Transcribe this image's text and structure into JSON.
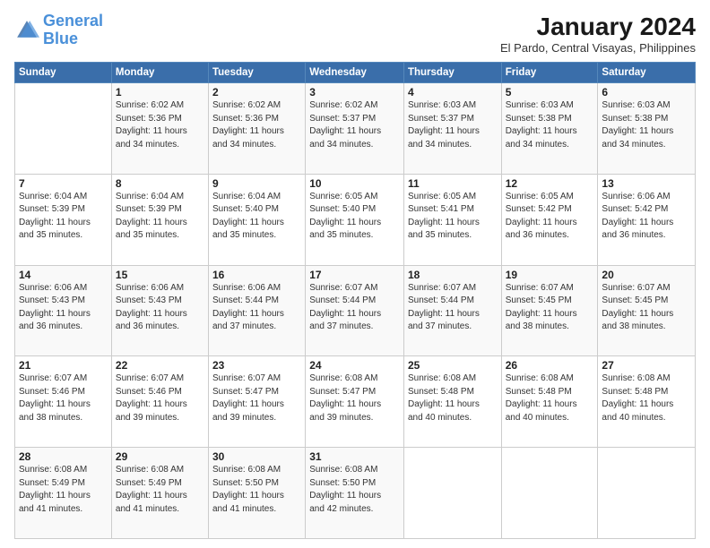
{
  "logo": {
    "line1": "General",
    "line2": "Blue"
  },
  "title": "January 2024",
  "location": "El Pardo, Central Visayas, Philippines",
  "days_header": [
    "Sunday",
    "Monday",
    "Tuesday",
    "Wednesday",
    "Thursday",
    "Friday",
    "Saturday"
  ],
  "weeks": [
    [
      {
        "day": "",
        "sunrise": "",
        "sunset": "",
        "daylight": ""
      },
      {
        "day": "1",
        "sunrise": "Sunrise: 6:02 AM",
        "sunset": "Sunset: 5:36 PM",
        "daylight": "Daylight: 11 hours and 34 minutes."
      },
      {
        "day": "2",
        "sunrise": "Sunrise: 6:02 AM",
        "sunset": "Sunset: 5:36 PM",
        "daylight": "Daylight: 11 hours and 34 minutes."
      },
      {
        "day": "3",
        "sunrise": "Sunrise: 6:02 AM",
        "sunset": "Sunset: 5:37 PM",
        "daylight": "Daylight: 11 hours and 34 minutes."
      },
      {
        "day": "4",
        "sunrise": "Sunrise: 6:03 AM",
        "sunset": "Sunset: 5:37 PM",
        "daylight": "Daylight: 11 hours and 34 minutes."
      },
      {
        "day": "5",
        "sunrise": "Sunrise: 6:03 AM",
        "sunset": "Sunset: 5:38 PM",
        "daylight": "Daylight: 11 hours and 34 minutes."
      },
      {
        "day": "6",
        "sunrise": "Sunrise: 6:03 AM",
        "sunset": "Sunset: 5:38 PM",
        "daylight": "Daylight: 11 hours and 34 minutes."
      }
    ],
    [
      {
        "day": "7",
        "sunrise": "Sunrise: 6:04 AM",
        "sunset": "Sunset: 5:39 PM",
        "daylight": "Daylight: 11 hours and 35 minutes."
      },
      {
        "day": "8",
        "sunrise": "Sunrise: 6:04 AM",
        "sunset": "Sunset: 5:39 PM",
        "daylight": "Daylight: 11 hours and 35 minutes."
      },
      {
        "day": "9",
        "sunrise": "Sunrise: 6:04 AM",
        "sunset": "Sunset: 5:40 PM",
        "daylight": "Daylight: 11 hours and 35 minutes."
      },
      {
        "day": "10",
        "sunrise": "Sunrise: 6:05 AM",
        "sunset": "Sunset: 5:40 PM",
        "daylight": "Daylight: 11 hours and 35 minutes."
      },
      {
        "day": "11",
        "sunrise": "Sunrise: 6:05 AM",
        "sunset": "Sunset: 5:41 PM",
        "daylight": "Daylight: 11 hours and 35 minutes."
      },
      {
        "day": "12",
        "sunrise": "Sunrise: 6:05 AM",
        "sunset": "Sunset: 5:42 PM",
        "daylight": "Daylight: 11 hours and 36 minutes."
      },
      {
        "day": "13",
        "sunrise": "Sunrise: 6:06 AM",
        "sunset": "Sunset: 5:42 PM",
        "daylight": "Daylight: 11 hours and 36 minutes."
      }
    ],
    [
      {
        "day": "14",
        "sunrise": "Sunrise: 6:06 AM",
        "sunset": "Sunset: 5:43 PM",
        "daylight": "Daylight: 11 hours and 36 minutes."
      },
      {
        "day": "15",
        "sunrise": "Sunrise: 6:06 AM",
        "sunset": "Sunset: 5:43 PM",
        "daylight": "Daylight: 11 hours and 36 minutes."
      },
      {
        "day": "16",
        "sunrise": "Sunrise: 6:06 AM",
        "sunset": "Sunset: 5:44 PM",
        "daylight": "Daylight: 11 hours and 37 minutes."
      },
      {
        "day": "17",
        "sunrise": "Sunrise: 6:07 AM",
        "sunset": "Sunset: 5:44 PM",
        "daylight": "Daylight: 11 hours and 37 minutes."
      },
      {
        "day": "18",
        "sunrise": "Sunrise: 6:07 AM",
        "sunset": "Sunset: 5:44 PM",
        "daylight": "Daylight: 11 hours and 37 minutes."
      },
      {
        "day": "19",
        "sunrise": "Sunrise: 6:07 AM",
        "sunset": "Sunset: 5:45 PM",
        "daylight": "Daylight: 11 hours and 38 minutes."
      },
      {
        "day": "20",
        "sunrise": "Sunrise: 6:07 AM",
        "sunset": "Sunset: 5:45 PM",
        "daylight": "Daylight: 11 hours and 38 minutes."
      }
    ],
    [
      {
        "day": "21",
        "sunrise": "Sunrise: 6:07 AM",
        "sunset": "Sunset: 5:46 PM",
        "daylight": "Daylight: 11 hours and 38 minutes."
      },
      {
        "day": "22",
        "sunrise": "Sunrise: 6:07 AM",
        "sunset": "Sunset: 5:46 PM",
        "daylight": "Daylight: 11 hours and 39 minutes."
      },
      {
        "day": "23",
        "sunrise": "Sunrise: 6:07 AM",
        "sunset": "Sunset: 5:47 PM",
        "daylight": "Daylight: 11 hours and 39 minutes."
      },
      {
        "day": "24",
        "sunrise": "Sunrise: 6:08 AM",
        "sunset": "Sunset: 5:47 PM",
        "daylight": "Daylight: 11 hours and 39 minutes."
      },
      {
        "day": "25",
        "sunrise": "Sunrise: 6:08 AM",
        "sunset": "Sunset: 5:48 PM",
        "daylight": "Daylight: 11 hours and 40 minutes."
      },
      {
        "day": "26",
        "sunrise": "Sunrise: 6:08 AM",
        "sunset": "Sunset: 5:48 PM",
        "daylight": "Daylight: 11 hours and 40 minutes."
      },
      {
        "day": "27",
        "sunrise": "Sunrise: 6:08 AM",
        "sunset": "Sunset: 5:48 PM",
        "daylight": "Daylight: 11 hours and 40 minutes."
      }
    ],
    [
      {
        "day": "28",
        "sunrise": "Sunrise: 6:08 AM",
        "sunset": "Sunset: 5:49 PM",
        "daylight": "Daylight: 11 hours and 41 minutes."
      },
      {
        "day": "29",
        "sunrise": "Sunrise: 6:08 AM",
        "sunset": "Sunset: 5:49 PM",
        "daylight": "Daylight: 11 hours and 41 minutes."
      },
      {
        "day": "30",
        "sunrise": "Sunrise: 6:08 AM",
        "sunset": "Sunset: 5:50 PM",
        "daylight": "Daylight: 11 hours and 41 minutes."
      },
      {
        "day": "31",
        "sunrise": "Sunrise: 6:08 AM",
        "sunset": "Sunset: 5:50 PM",
        "daylight": "Daylight: 11 hours and 42 minutes."
      },
      {
        "day": "",
        "sunrise": "",
        "sunset": "",
        "daylight": ""
      },
      {
        "day": "",
        "sunrise": "",
        "sunset": "",
        "daylight": ""
      },
      {
        "day": "",
        "sunrise": "",
        "sunset": "",
        "daylight": ""
      }
    ]
  ]
}
